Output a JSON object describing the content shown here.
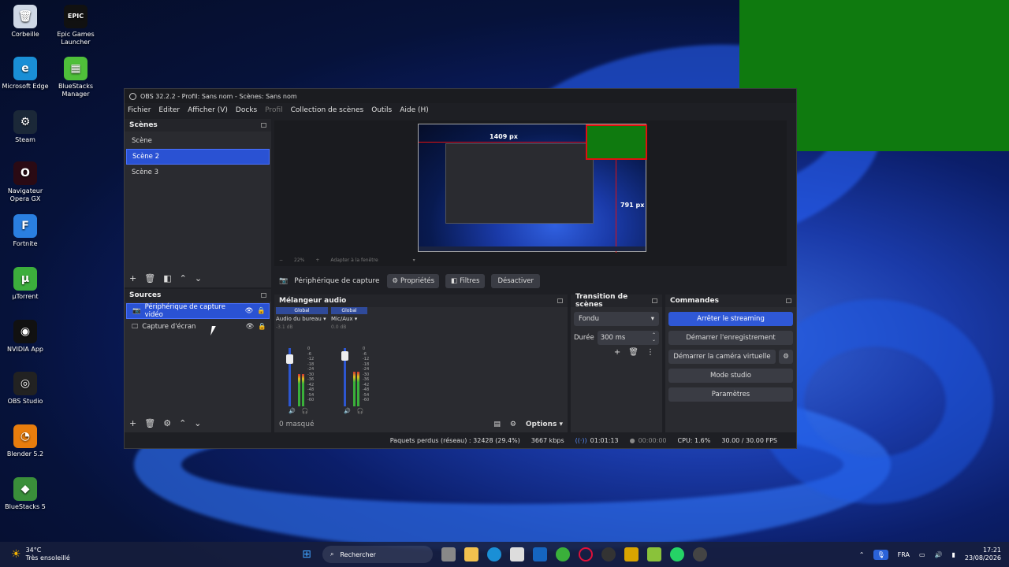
{
  "desktop_icons": [
    {
      "label": "Corbeille",
      "icon": "recycle-bin-icon",
      "glyph": "🗑",
      "bg": "#cfd8e6"
    },
    {
      "label": "Epic Games Launcher",
      "icon": "epic-games-icon",
      "glyph": "EPIC",
      "bg": "#111"
    },
    {
      "label": "Microsoft Edge",
      "icon": "edge-icon",
      "glyph": "e",
      "bg": "#1a8fd6"
    },
    {
      "label": "BlueStacks Manager",
      "icon": "bluestacks-manager-icon",
      "glyph": "▦",
      "bg": "#4fbf3a"
    },
    {
      "label": "Steam",
      "icon": "steam-icon",
      "glyph": "⚙",
      "bg": "#1b2838"
    },
    {
      "label": "Navigateur Opera GX",
      "icon": "opera-gx-icon",
      "glyph": "O",
      "bg": "#2a0a14"
    },
    {
      "label": "Fortnite",
      "icon": "fortnite-icon",
      "glyph": "F",
      "bg": "#2a7fe0"
    },
    {
      "label": "µTorrent",
      "icon": "utorrent-icon",
      "glyph": "µ",
      "bg": "#3cae3c"
    },
    {
      "label": "NVIDIA App",
      "icon": "nvidia-icon",
      "glyph": "◉",
      "bg": "#111"
    },
    {
      "label": "OBS Studio",
      "icon": "obs-icon",
      "glyph": "◎",
      "bg": "#222"
    },
    {
      "label": "Blender 5.2",
      "icon": "blender-icon",
      "glyph": "◔",
      "bg": "#e87d0d"
    },
    {
      "label": "BlueStacks 5",
      "icon": "bluestacks-icon",
      "glyph": "◆",
      "bg": "#3a8f3a"
    }
  ],
  "window": {
    "title": "OBS 32.2.2 - Profil: Sans nom - Scènes: Sans nom"
  },
  "menu": [
    "Fichier",
    "Editer",
    "Afficher (V)",
    "Docks",
    "Profil",
    "Collection de scènes",
    "Outils",
    "Aide (H)"
  ],
  "scenes": {
    "title": "Scènes",
    "items": [
      "Scène",
      "Scène 2",
      "Scène 3"
    ],
    "selected_index": 1
  },
  "sources": {
    "title": "Sources",
    "items": [
      "Périphérique de capture vidéo",
      "Capture d'écran"
    ],
    "selected_index": 0
  },
  "preview": {
    "width_label": "1409 px",
    "height_label": "791 px",
    "zoom": "22%",
    "fit_label": "Adapter à la fenêtre"
  },
  "context_bar": {
    "source_name": "Périphérique de capture vic",
    "properties": "Propriétés",
    "filters": "Filtres",
    "deactivate": "Désactiver"
  },
  "mixer": {
    "title": "Mélangeur audio",
    "channels": [
      {
        "header": "Global",
        "name": "Audio du bureau",
        "db": "-3.1 dB",
        "level": 0.55
      },
      {
        "header": "Global",
        "name": "Mic/Aux",
        "db": "0.0 dB",
        "level": 0.6
      }
    ],
    "scale": [
      "0",
      "-6",
      "-12",
      "-18",
      "-24",
      "-30",
      "-36",
      "-42",
      "-48",
      "-54",
      "-60"
    ],
    "hidden": "0 masqué",
    "options": "Options"
  },
  "transitions": {
    "title": "Transition de scènes",
    "type": "Fondu",
    "duration_label": "Durée",
    "duration_value": "300 ms"
  },
  "controls": {
    "title": "Commandes",
    "buttons": [
      "Arrêter le streaming",
      "Démarrer l'enregistrement",
      "Démarrer la caméra virtuelle",
      "Mode studio",
      "Paramètres"
    ]
  },
  "status": {
    "dropped": "Paquets perdus (réseau) : 32428 (29.4%)",
    "bitrate": "3667 kbps",
    "stream_time": "01:01:13",
    "rec_time": "00:00:00",
    "cpu": "CPU: 1.6%",
    "fps": "30.00 / 30.00 FPS"
  },
  "taskbar": {
    "weather_temp": "34°C",
    "weather_desc": "Très ensoleillé",
    "search": "Rechercher",
    "lang": "FRA",
    "time": "17:21",
    "date": "23/08/2026"
  },
  "colors": {
    "accent": "#2f58d6",
    "green_capture": "#0f7a0f",
    "measure_red": "#e01010"
  }
}
